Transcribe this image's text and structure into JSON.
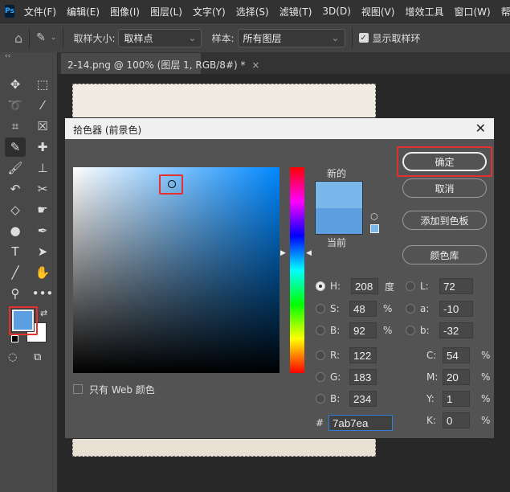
{
  "app": {
    "logo": "Ps"
  },
  "menu": [
    "文件(F)",
    "编辑(E)",
    "图像(I)",
    "图层(L)",
    "文字(Y)",
    "选择(S)",
    "滤镜(T)",
    "3D(D)",
    "视图(V)",
    "增效工具",
    "窗口(W)",
    "帮助(H)"
  ],
  "options": {
    "sample_size_label": "取样大小:",
    "sample_size_value": "取样点",
    "sample_label": "样本:",
    "sample_value": "所有图层",
    "show_ring_label": "显示取样环",
    "show_ring_checked": true
  },
  "tab": {
    "title": "2-14.png @ 100% (图层 1, RGB/8#) *",
    "close": "×",
    "collapse": "‹‹"
  },
  "dialog": {
    "title": "拾色器 (前景色)",
    "close": "✕",
    "new_label": "新的",
    "current_label": "当前",
    "new_color": "#7ab7ea",
    "current_color": "#5b9fe0",
    "buttons": {
      "ok": "确定",
      "cancel": "取消",
      "add_swatch": "添加到色板",
      "color_library": "颜色库"
    },
    "web_only_label": "只有 Web 颜色",
    "web_only_checked": false,
    "fields": {
      "H": {
        "label": "H:",
        "value": "208",
        "unit": "度"
      },
      "S": {
        "label": "S:",
        "value": "48",
        "unit": "%"
      },
      "Bv": {
        "label": "B:",
        "value": "92",
        "unit": "%"
      },
      "R": {
        "label": "R:",
        "value": "122"
      },
      "G": {
        "label": "G:",
        "value": "183"
      },
      "B": {
        "label": "B:",
        "value": "234"
      },
      "L": {
        "label": "L:",
        "value": "72"
      },
      "a": {
        "label": "a:",
        "value": "-10"
      },
      "b": {
        "label": "b:",
        "value": "-32"
      },
      "C": {
        "label": "C:",
        "value": "54",
        "unit": "%"
      },
      "M": {
        "label": "M:",
        "value": "20",
        "unit": "%"
      },
      "Y": {
        "label": "Y:",
        "value": "1",
        "unit": "%"
      },
      "K": {
        "label": "K:",
        "value": "0",
        "unit": "%"
      }
    },
    "hex_label": "#",
    "hex": "7ab7ea"
  },
  "foreground_color": "#5b9fe0",
  "background_color": "#ffffff"
}
